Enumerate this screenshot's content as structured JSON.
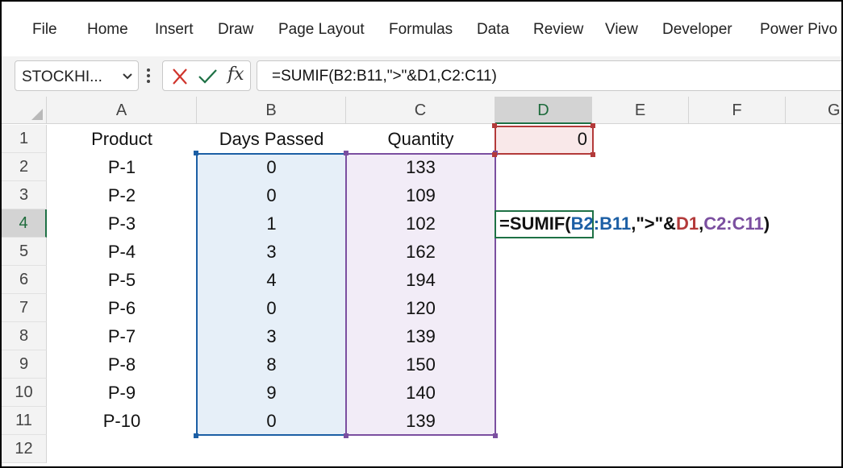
{
  "ribbon": {
    "tabs": [
      "File",
      "Home",
      "Insert",
      "Draw",
      "Page Layout",
      "Formulas",
      "Data",
      "Review",
      "View",
      "Developer",
      "Power Pivo"
    ]
  },
  "formula_bar": {
    "name_box": "STOCKHI...",
    "fx_label": "fx",
    "formula": "=SUMIF(B2:B11,\">\"&D1,C2:C11)"
  },
  "sheet": {
    "columns": [
      "A",
      "B",
      "C",
      "D",
      "E",
      "F",
      "G"
    ],
    "rows": [
      "1",
      "2",
      "3",
      "4",
      "5",
      "6",
      "7",
      "8",
      "9",
      "10",
      "11",
      "12"
    ],
    "selected_cell": "D4",
    "headers": {
      "a": "Product",
      "b": "Days Passed",
      "c": "Quantity"
    },
    "d1_value": "0",
    "data": [
      {
        "product": "P-1",
        "days": "0",
        "quantity": "133"
      },
      {
        "product": "P-2",
        "days": "0",
        "quantity": "109"
      },
      {
        "product": "P-3",
        "days": "1",
        "quantity": "102"
      },
      {
        "product": "P-4",
        "days": "3",
        "quantity": "162"
      },
      {
        "product": "P-5",
        "days": "4",
        "quantity": "194"
      },
      {
        "product": "P-6",
        "days": "0",
        "quantity": "120"
      },
      {
        "product": "P-7",
        "days": "3",
        "quantity": "139"
      },
      {
        "product": "P-8",
        "days": "8",
        "quantity": "150"
      },
      {
        "product": "P-9",
        "days": "9",
        "quantity": "140"
      },
      {
        "product": "P-10",
        "days": "0",
        "quantity": "139"
      }
    ],
    "edit_formula": {
      "p1": "=SUMIF(",
      "r1": "B2:B11",
      "p2": ",\">\"&",
      "r2": "D1",
      "p3": ",",
      "r3": "C2:C11",
      "p4": ")"
    }
  },
  "colors": {
    "range1": "#1c5fa5",
    "range2": "#b33a3a",
    "range3": "#7b4fa0",
    "selection": "#1e7145"
  }
}
